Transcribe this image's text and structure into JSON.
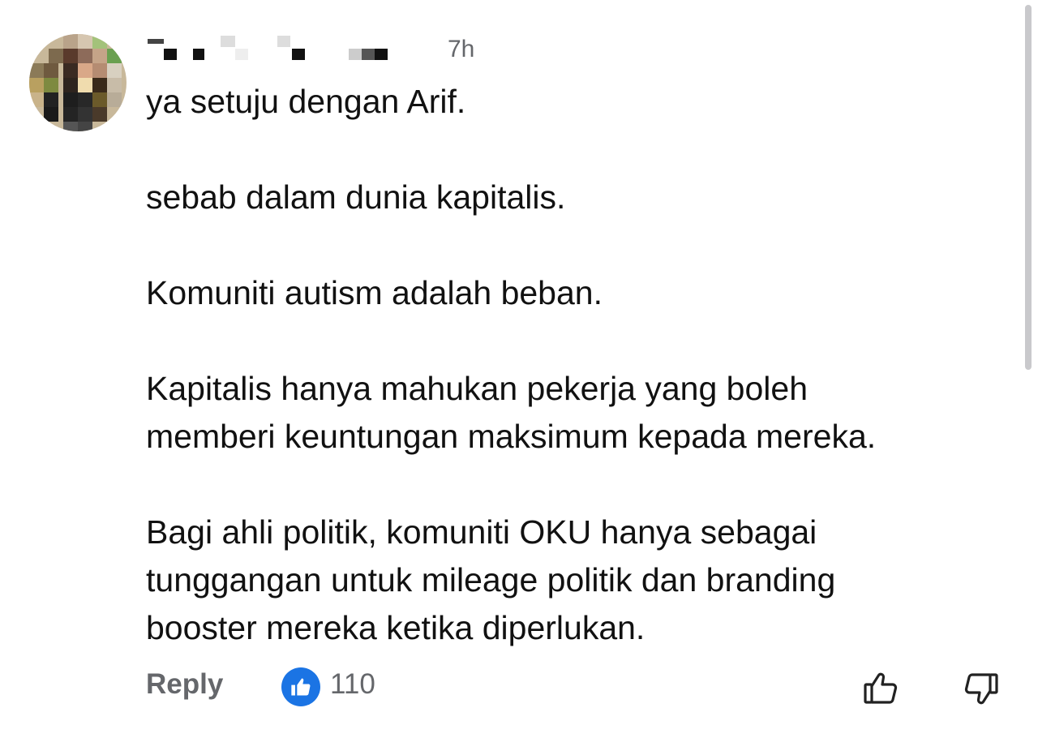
{
  "comment": {
    "timestamp": "7h",
    "paragraphs": [
      "ya setuju dengan Arif.",
      "sebab dalam dunia kapitalis.",
      "Komuniti autism adalah beban.",
      "Kapitalis hanya mahukan pekerja yang boleh\nmemberi keuntungan maksimum kepada mereka.",
      "Bagi ahli politik, komuniti OKU hanya sebagai\ntunggangan untuk mileage politik dan branding\nbooster mereka ketika diperlukan."
    ]
  },
  "actions": {
    "reply_label": "Reply",
    "like_count": "110"
  },
  "icons": {
    "like_badge": "thumbs-up-icon",
    "like_button": "thumbs-up-outline-icon",
    "dislike_button": "thumbs-down-outline-icon"
  },
  "colors": {
    "accent_blue": "#1b74e4",
    "secondary_text": "#65676b",
    "primary_text": "#111111"
  }
}
